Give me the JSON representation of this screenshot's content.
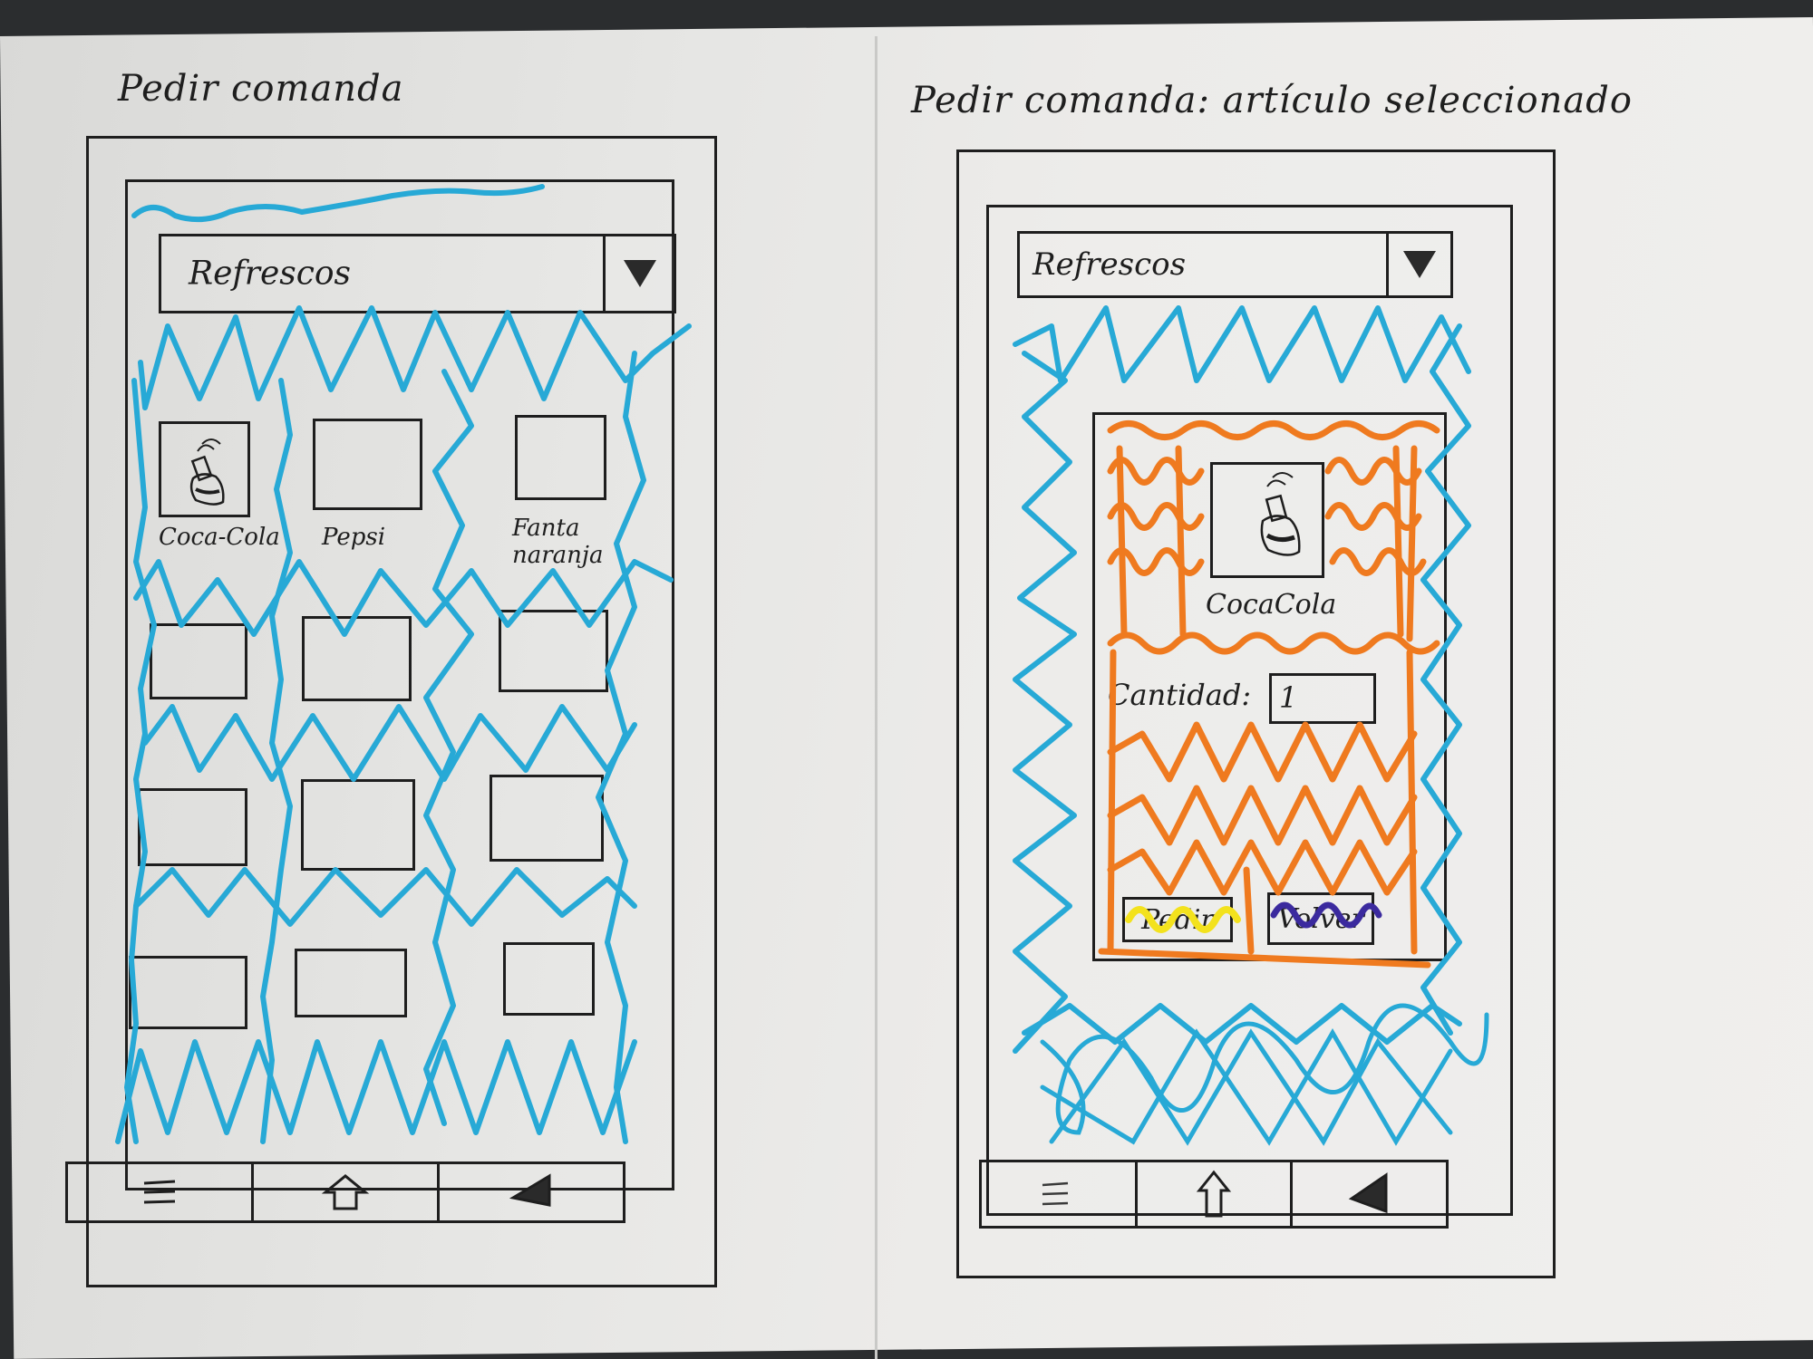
{
  "sheets": [
    {
      "title": "Pedir comanda",
      "dropdown": {
        "selected": "Refrescos"
      },
      "products": [
        {
          "label": "Coca-Cola",
          "icon": "bottle-icon"
        },
        {
          "label": "Pepsi",
          "icon": ""
        },
        {
          "label": "Fanta naranja",
          "icon": ""
        }
      ],
      "nav": {
        "menu_icon": "menu-icon",
        "home_icon": "home-icon",
        "back_icon": "back-icon"
      }
    },
    {
      "title": "Pedir comanda: artículo seleccionado",
      "dropdown": {
        "selected": "Refrescos"
      },
      "selected_product": {
        "label": "CocaCola",
        "icon": "bottle-icon"
      },
      "quantity": {
        "label": "Cantidad:",
        "value": "1"
      },
      "buttons": {
        "order_label": "Pedir",
        "back_label": "Volver"
      },
      "nav": {
        "menu_icon": "menu-icon",
        "home_icon": "home-icon",
        "back_icon": "back-icon"
      }
    }
  ],
  "colors": {
    "ink": "#1e1e1e",
    "blue_marker": "#27a9d6",
    "orange_marker": "#ef7a1f",
    "yellow_marker": "#f3e21d",
    "purple_marker": "#3b2a9e"
  }
}
